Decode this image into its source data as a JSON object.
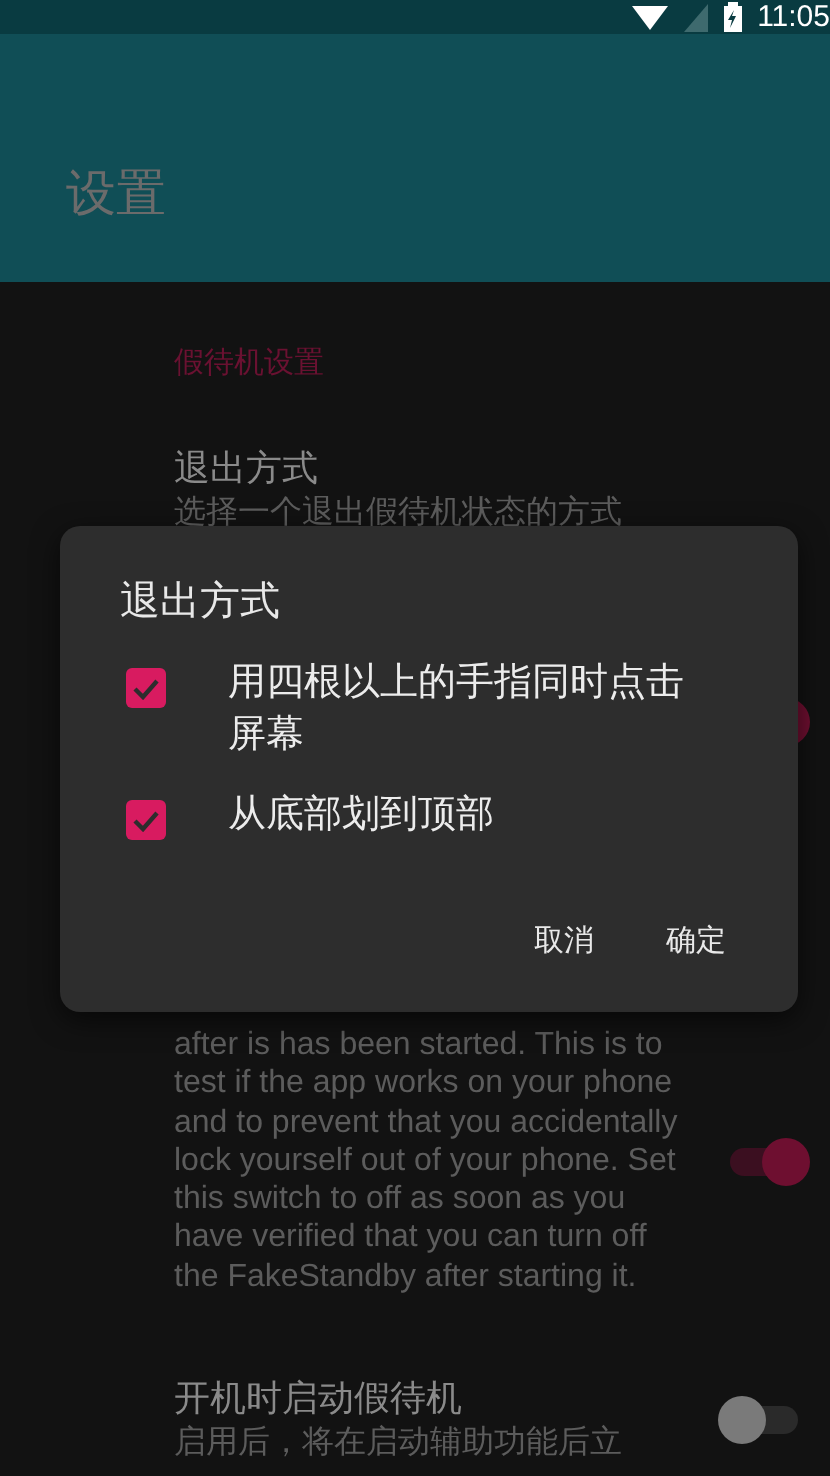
{
  "status_bar": {
    "time": "11:05"
  },
  "app_bar": {
    "title": "设置"
  },
  "category": "假待机设置",
  "preferences": [
    {
      "kind": "text",
      "title": "退出方式",
      "summary": "选择一个退出假待机状态的方式"
    },
    {
      "kind": "switch",
      "on": true
    },
    {
      "kind": "switch",
      "on": true,
      "summary": "after is has been started. This is to test if the app works on your phone and to prevent that you accidentally lock yourself out of your phone. Set this switch to off as soon as you have verified that you can turn off the FakeStandby after starting it."
    },
    {
      "kind": "switch",
      "on": false,
      "title": "开机时启动假待机",
      "summary": "启用后，将在启动辅助功能后立"
    }
  ],
  "dialog": {
    "title": "退出方式",
    "options": [
      {
        "label": "用四根以上的手指同时点击屏幕",
        "checked": true
      },
      {
        "label": "从底部划到顶部",
        "checked": true
      }
    ],
    "buttons": [
      "取消",
      "确定"
    ]
  }
}
